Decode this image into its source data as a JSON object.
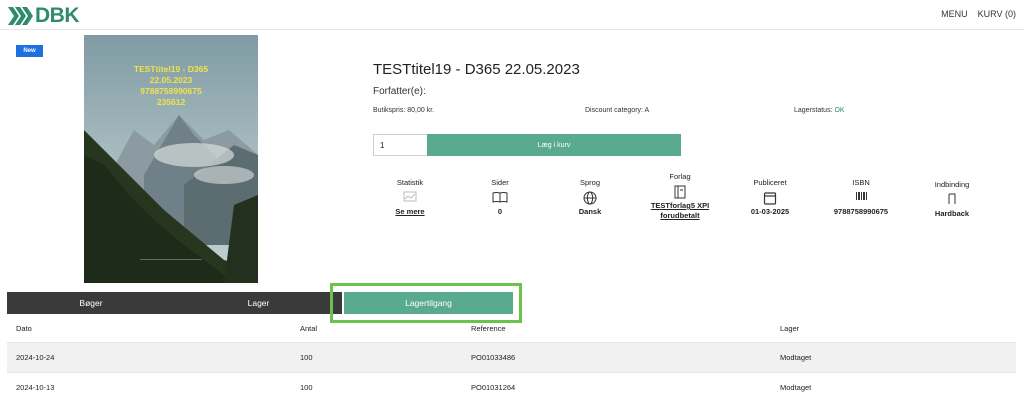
{
  "header": {
    "logo_text": "DBK",
    "menu_label": "MENU",
    "cart_label": "KURV (0)"
  },
  "product": {
    "badge": "New",
    "cover_text_lines": [
      "TESTtitel19 - D365",
      "22.05.2023",
      "9788758990675",
      "235612"
    ],
    "title": "TESTtitel19 - D365 22.05.2023",
    "author_label": "Forfatter(e):",
    "price": "Butikspris: 80,00 kr.",
    "discount": "Discount category: A",
    "stock_label": "Lagerstatus:",
    "stock_value": "OK",
    "quantity_value": "1",
    "add_to_cart_label": "Læg i kurv",
    "accent_color": "#5aaa8d",
    "badge_color": "#1e6fe0"
  },
  "attributes": [
    {
      "label": "Statistik",
      "icon": "chart-icon",
      "value": "Se mere",
      "is_link": true
    },
    {
      "label": "Sider",
      "icon": "book-icon",
      "value": "0",
      "is_link": false
    },
    {
      "label": "Sprog",
      "icon": "globe-icon",
      "value": "Dansk",
      "is_link": false
    },
    {
      "label": "Forlag",
      "icon": "publisher-book-icon",
      "value": "TESTforlag5 XPI forudbetalt",
      "is_link": true
    },
    {
      "label": "Publiceret",
      "icon": "calendar-icon",
      "value": "01-03-2025",
      "is_link": false
    },
    {
      "label": "ISBN",
      "icon": "barcode-icon",
      "value": "9788758990675",
      "is_link": false
    },
    {
      "label": "Indbinding",
      "icon": "binding-icon",
      "value": "Hardback",
      "is_link": false
    }
  ],
  "tabs": [
    {
      "label": "Bøger",
      "active": false
    },
    {
      "label": "Lager",
      "active": false
    },
    {
      "label": "Lagertilgang",
      "active": true
    }
  ],
  "table": {
    "columns": [
      "Dato",
      "Antal",
      "Reference",
      "Lager"
    ],
    "rows": [
      [
        "2024-10-24",
        "100",
        "PO01033486",
        "Modtaget"
      ],
      [
        "2024-10-13",
        "100",
        "PO01031264",
        "Modtaget"
      ]
    ]
  }
}
